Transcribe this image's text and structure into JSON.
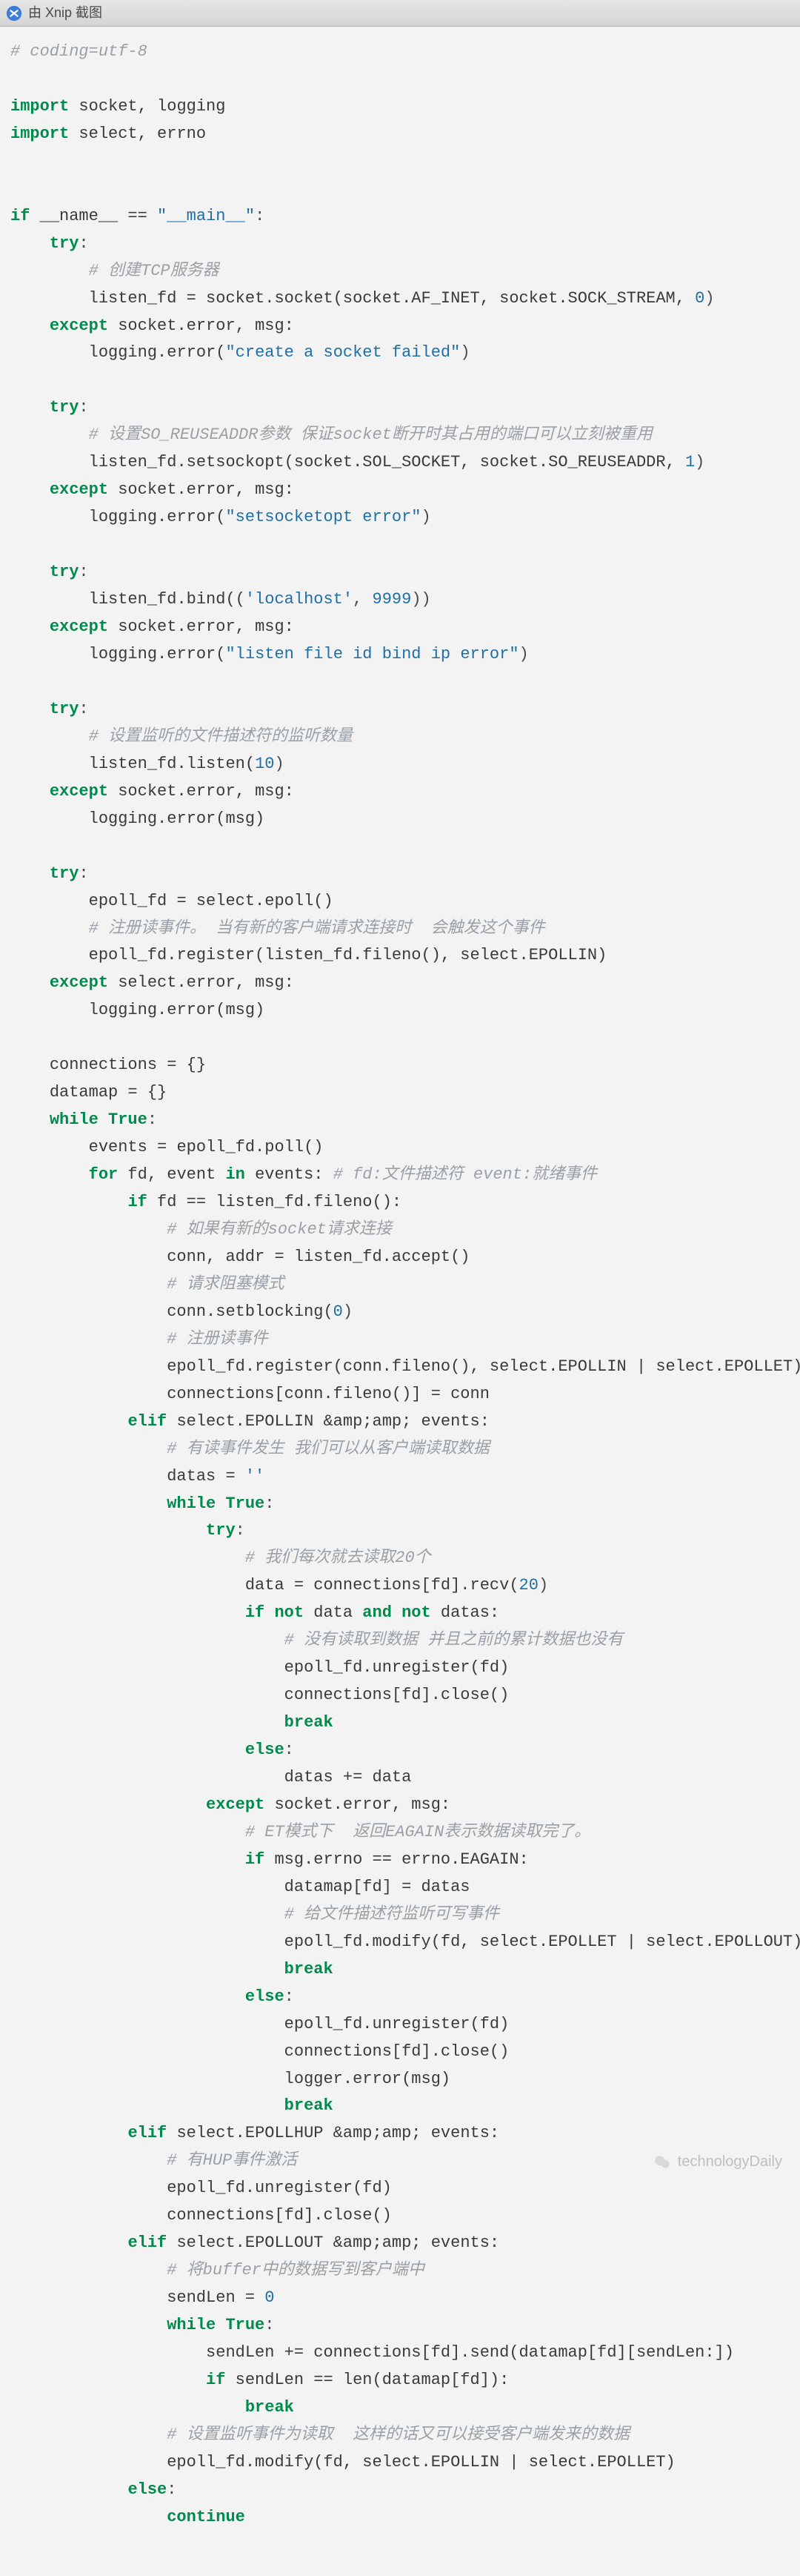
{
  "titlebar": {
    "label": "由 Xnip 截图"
  },
  "watermark": {
    "text": "technologyDaily"
  },
  "code": {
    "l01": "# coding=utf-8",
    "l02": "import",
    "l03": " socket, logging",
    "l04": "import",
    "l05": " select, errno",
    "l06": "if",
    "l07": " __name__ == ",
    "l08": "\"__main__\"",
    "l09": ":",
    "t01": "try",
    "t02": ":",
    "c01": "# 创建TCP服务器",
    "a01": "listen_fd = socket.socket(socket.AF_INET, socket.SOCK_STREAM, ",
    "n0": "0",
    "a01b": ")",
    "e01": "except",
    "e01b": " socket.error, msg:",
    "a02a": "logging.error(",
    "s01": "\"create a socket failed\"",
    "a02b": ")",
    "c02": "# 设置SO_REUSEADDR参数 保证socket断开时其占用的端口可以立刻被重用",
    "a03": "listen_fd.setsockopt(socket.SOL_SOCKET, socket.SO_REUSEADDR, ",
    "n1": "1",
    "a03b": ")",
    "a04a": "logging.error(",
    "s02": "\"setsocketopt error\"",
    "a04b": ")",
    "a05a": "listen_fd.bind((",
    "s03": "'localhost'",
    "a05b": ", ",
    "n9999": "9999",
    "a05c": "))",
    "a06a": "logging.error(",
    "s04": "\"listen file id bind ip error\"",
    "a06b": ")",
    "c03": "# 设置监听的文件描述符的监听数量",
    "a07a": "listen_fd.listen(",
    "n10": "10",
    "a07b": ")",
    "a08": "logging.error(msg)",
    "a09": "epoll_fd = select.epoll()",
    "c04": "# 注册读事件。 当有新的客户端请求连接时  会触发这个事件",
    "a10": "epoll_fd.register(listen_fd.fileno(), select.EPOLLIN)",
    "e02b": " select.error, msg:",
    "a11": "connections = {}",
    "a12": "datamap = {}",
    "w01": "while",
    "w01b": " ",
    "w01c": "True",
    "w01d": ":",
    "a13": "events = epoll_fd.poll()",
    "f01": "for",
    "f01b": " fd, event ",
    "f01c": "in",
    "f01d": " events: ",
    "c05": "# fd:文件描述符 event:就绪事件",
    "if01": "if",
    "if01b": " fd == listen_fd.fileno():",
    "c06": "# 如果有新的socket请求连接",
    "a14": "conn, addr = listen_fd.accept()",
    "c07": "# 请求阻塞模式",
    "a15a": "conn.setblocking(",
    "a15b": ")",
    "c08": "# 注册读事件",
    "a16": "epoll_fd.register(conn.fileno(), select.EPOLLIN | select.EPOLLET)",
    "a17": "connections[conn.fileno()] = conn",
    "el01": "elif",
    "el01b": " select.EPOLLIN &amp;amp; events:",
    "c09": "# 有读事件发生 我们可以从客户端读取数据",
    "a18a": "datas = ",
    "s05": "''",
    "c10": "# 我们每次就去读取20个",
    "a19a": "data = connections[fd].recv(",
    "n20": "20",
    "a19b": ")",
    "if02": "if",
    "if02b": " ",
    "not": "not",
    "if02c": " data ",
    "and": "and",
    "if02d": " datas:",
    "c11": "# 没有读取到数据 并且之前的累计数据也没有",
    "a20": "epoll_fd.unregister(fd)",
    "a21": "connections[fd].close()",
    "br": "break",
    "el02": "else",
    "a22": "datas += data",
    "e03b": " socket.error, msg:",
    "c12": "# ET模式下  返回EAGAIN表示数据读取完了。",
    "if03b": " msg.errno == errno.EAGAIN:",
    "a23": "datamap[fd] = datas",
    "c13": "# 给文件描述符监听可写事件",
    "a24": "epoll_fd.modify(fd, select.EPOLLET | select.EPOLLOUT)",
    "a25": "logger.error(msg)",
    "el03b": " select.EPOLLHUP &amp;amp; events:",
    "c14": "# 有HUP事件激活",
    "el04b": " select.EPOLLOUT &amp;amp; events:",
    "c15": "# 将buffer中的数据写到客户端中",
    "a26a": "sendLen = ",
    "a27": "sendLen += connections[fd].send(datamap[fd][sendLen:])",
    "if04b": " sendLen == len(datamap[fd]):",
    "c16": "# 设置监听事件为读取  这样的话又可以接受客户端发来的数据",
    "a28": "epoll_fd.modify(fd, select.EPOLLIN | select.EPOLLET)",
    "cont": "continue"
  }
}
